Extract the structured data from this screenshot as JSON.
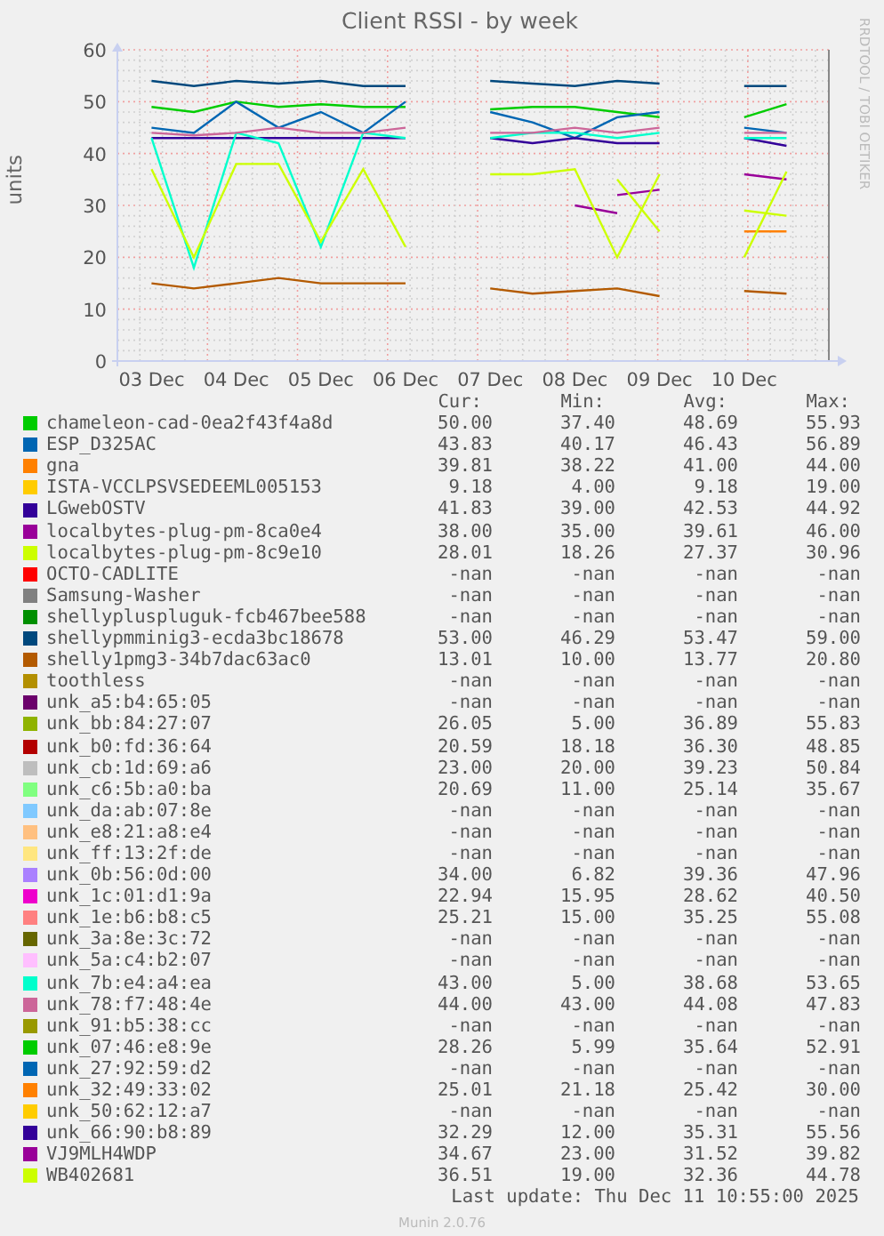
{
  "chart": {
    "side_label": "RRDTOOL / TOBI OETIKER",
    "chart_data": {
      "type": "line",
      "title": "Client RSSI - by week",
      "ylabel": "units",
      "categories": [
        "03 Dec",
        null,
        "04 Dec",
        null,
        "05 Dec",
        null,
        "06 Dec",
        null,
        "07 Dec",
        null,
        "08 Dec",
        null,
        "09 Dec",
        null,
        "10 Dec",
        null
      ],
      "ylim": [
        0,
        60
      ],
      "grid": true,
      "yticks": [
        0,
        10,
        20,
        30,
        40,
        50,
        60
      ],
      "series": [
        {
          "name": "chameleon-cad-0ea2f43f4a8d",
          "color": "#00cc00",
          "values": [
            49,
            48,
            50,
            49,
            49.5,
            49,
            49,
            null,
            48.5,
            49,
            49,
            48,
            47,
            null,
            47,
            49.5
          ]
        },
        {
          "name": "ESP_D325AC",
          "color": "#0066b3",
          "values": [
            45,
            44,
            50,
            45,
            48,
            44,
            50,
            null,
            48,
            46,
            43,
            47,
            48,
            null,
            45,
            44
          ]
        },
        {
          "name": "gna",
          "color": "#ff8000",
          "values": [
            null,
            null,
            null,
            null,
            null,
            null,
            null,
            null,
            null,
            null,
            null,
            null,
            null,
            null,
            null,
            null
          ]
        },
        {
          "name": "ISTA-VCCLPSVSEDEEML005153",
          "color": "#ffcc00",
          "values": [
            null,
            null,
            null,
            null,
            null,
            null,
            null,
            null,
            null,
            null,
            null,
            null,
            null,
            null,
            null,
            null
          ]
        },
        {
          "name": "LGwebOSTV",
          "color": "#330099",
          "values": [
            43,
            43,
            43,
            43,
            43,
            43,
            43,
            null,
            43,
            42,
            43,
            42,
            42,
            null,
            43,
            41.5
          ]
        },
        {
          "name": "localbytes-plug-pm-8ca0e4",
          "color": "#990099",
          "values": [
            null,
            null,
            null,
            null,
            null,
            null,
            null,
            null,
            null,
            null,
            null,
            32,
            33,
            null,
            36,
            35
          ]
        },
        {
          "name": "localbytes-plug-pm-8c9e10",
          "color": "#ccff00",
          "values": [
            null,
            null,
            null,
            null,
            null,
            null,
            null,
            null,
            null,
            null,
            null,
            35,
            25,
            null,
            29,
            28
          ]
        },
        {
          "name": "OCTO-CADLITE",
          "color": "#ff0000",
          "values": [
            null,
            null,
            null,
            null,
            null,
            null,
            null,
            null,
            null,
            null,
            null,
            null,
            null,
            null,
            null,
            null
          ]
        },
        {
          "name": "Samsung-Washer",
          "color": "#808080",
          "values": [
            null,
            null,
            null,
            null,
            null,
            null,
            null,
            null,
            null,
            null,
            null,
            null,
            null,
            null,
            null,
            null
          ]
        },
        {
          "name": "shellypluspluguk-fcb467bee588",
          "color": "#008f00",
          "values": [
            null,
            null,
            null,
            null,
            null,
            null,
            null,
            null,
            null,
            null,
            null,
            null,
            null,
            null,
            null,
            null
          ]
        },
        {
          "name": "shellypmminig3-ecda3bc18678",
          "color": "#00487d",
          "values": [
            54,
            53,
            54,
            53.5,
            54,
            53,
            53,
            null,
            54,
            53.5,
            53,
            54,
            53.5,
            null,
            53,
            53
          ]
        },
        {
          "name": "shelly1pmg3-34b7dac63ac0",
          "color": "#b35a00",
          "values": [
            15,
            14,
            15,
            16,
            15,
            15,
            15,
            null,
            14,
            13,
            13.5,
            14,
            12.5,
            null,
            13.5,
            13
          ]
        },
        {
          "name": "toothless",
          "color": "#b38f00",
          "values": [
            null,
            null,
            null,
            null,
            null,
            null,
            null,
            null,
            null,
            null,
            null,
            null,
            null,
            null,
            null,
            null
          ]
        },
        {
          "name": "unk_a5:b4:65:05",
          "color": "#6b006b",
          "values": [
            null,
            null,
            null,
            null,
            null,
            null,
            null,
            null,
            null,
            null,
            null,
            null,
            null,
            null,
            null,
            null
          ]
        },
        {
          "name": "unk_bb:84:27:07",
          "color": "#8fb300",
          "values": [
            null,
            null,
            null,
            null,
            null,
            null,
            null,
            null,
            null,
            null,
            null,
            null,
            null,
            null,
            null,
            null
          ]
        },
        {
          "name": "unk_b0:fd:36:64",
          "color": "#b30000",
          "values": [
            null,
            null,
            null,
            null,
            null,
            null,
            null,
            null,
            null,
            null,
            null,
            null,
            null,
            null,
            null,
            null
          ]
        },
        {
          "name": "unk_cb:1d:69:a6",
          "color": "#bebebe",
          "values": [
            null,
            null,
            null,
            null,
            null,
            null,
            null,
            null,
            null,
            null,
            null,
            null,
            null,
            null,
            null,
            null
          ]
        },
        {
          "name": "unk_c6:5b:a0:ba",
          "color": "#80ff80",
          "values": [
            null,
            null,
            null,
            null,
            null,
            null,
            null,
            null,
            null,
            null,
            null,
            null,
            null,
            null,
            null,
            null
          ]
        },
        {
          "name": "unk_da:ab:07:8e",
          "color": "#80c9ff",
          "values": [
            null,
            null,
            null,
            null,
            null,
            null,
            null,
            null,
            null,
            null,
            null,
            null,
            null,
            null,
            null,
            null
          ]
        },
        {
          "name": "unk_e8:21:a8:e4",
          "color": "#ffc080",
          "values": [
            null,
            null,
            null,
            null,
            null,
            null,
            null,
            null,
            null,
            null,
            null,
            null,
            null,
            null,
            null,
            null
          ]
        },
        {
          "name": "unk_ff:13:2f:de",
          "color": "#ffe680",
          "values": [
            null,
            null,
            null,
            null,
            null,
            null,
            null,
            null,
            null,
            null,
            null,
            null,
            null,
            null,
            null,
            null
          ]
        },
        {
          "name": "unk_0b:56:0d:00",
          "color": "#aa80ff",
          "values": [
            null,
            null,
            null,
            null,
            null,
            null,
            null,
            null,
            null,
            null,
            null,
            null,
            null,
            null,
            null,
            null
          ]
        },
        {
          "name": "unk_1c:01:d1:9a",
          "color": "#ee00cc",
          "values": [
            null,
            null,
            null,
            null,
            null,
            null,
            null,
            null,
            null,
            null,
            null,
            null,
            null,
            null,
            null,
            null
          ]
        },
        {
          "name": "unk_1e:b6:b8:c5",
          "color": "#ff8080",
          "values": [
            null,
            null,
            null,
            null,
            null,
            null,
            null,
            null,
            null,
            null,
            null,
            null,
            null,
            null,
            null,
            null
          ]
        },
        {
          "name": "unk_3a:8e:3c:72",
          "color": "#666600",
          "values": [
            null,
            null,
            null,
            null,
            null,
            null,
            null,
            null,
            null,
            null,
            null,
            null,
            null,
            null,
            null,
            null
          ]
        },
        {
          "name": "unk_5a:c4:b2:07",
          "color": "#ffbfff",
          "values": [
            null,
            null,
            null,
            null,
            null,
            null,
            null,
            null,
            null,
            null,
            null,
            null,
            null,
            null,
            null,
            null
          ]
        },
        {
          "name": "unk_7b:e4:a4:ea",
          "color": "#00ffcc",
          "values": [
            43,
            18,
            44,
            42,
            22,
            44,
            43,
            null,
            43,
            44,
            44,
            43,
            44,
            null,
            43,
            43
          ]
        },
        {
          "name": "unk_78:f7:48:4e",
          "color": "#cc6699",
          "values": [
            44,
            43.5,
            44,
            45,
            44,
            44,
            45,
            null,
            44,
            44,
            45,
            44,
            45,
            null,
            44,
            44
          ]
        },
        {
          "name": "unk_91:b5:38:cc",
          "color": "#999900",
          "values": [
            null,
            null,
            null,
            null,
            null,
            null,
            null,
            null,
            null,
            null,
            null,
            null,
            null,
            null,
            null,
            null
          ]
        },
        {
          "name": "unk_07:46:e8:9e",
          "color": "#00cc00",
          "values": [
            null,
            null,
            null,
            null,
            null,
            null,
            null,
            null,
            null,
            null,
            null,
            null,
            null,
            null,
            null,
            null
          ]
        },
        {
          "name": "unk_27:92:59:d2",
          "color": "#0066b3",
          "values": [
            null,
            null,
            null,
            null,
            null,
            null,
            null,
            null,
            null,
            null,
            null,
            null,
            null,
            null,
            null,
            null
          ]
        },
        {
          "name": "unk_32:49:33:02",
          "color": "#ff8000",
          "values": [
            null,
            null,
            null,
            null,
            null,
            null,
            null,
            null,
            null,
            null,
            null,
            null,
            null,
            null,
            25,
            25
          ]
        },
        {
          "name": "unk_50:62:12:a7",
          "color": "#ffcc00",
          "values": [
            null,
            null,
            null,
            null,
            null,
            null,
            null,
            null,
            null,
            null,
            null,
            null,
            null,
            null,
            null,
            null
          ]
        },
        {
          "name": "unk_66:90:b8:89",
          "color": "#330099",
          "values": [
            null,
            null,
            null,
            null,
            null,
            null,
            null,
            null,
            null,
            null,
            null,
            null,
            null,
            null,
            null,
            null
          ]
        },
        {
          "name": "VJ9MLH4WDP",
          "color": "#990099",
          "values": [
            null,
            null,
            null,
            null,
            null,
            null,
            null,
            null,
            null,
            null,
            30,
            28.5,
            null,
            null,
            null,
            null
          ]
        },
        {
          "name": "WB402681",
          "color": "#ccff00",
          "values": [
            37,
            20,
            38,
            38,
            23,
            37,
            22,
            null,
            36,
            36,
            37,
            20,
            36,
            null,
            20,
            36.5
          ]
        }
      ]
    }
  },
  "legend": {
    "columns": [
      "Cur:",
      "Min:",
      "Avg:",
      "Max:"
    ],
    "rows": [
      {
        "cur": "50.00",
        "min": "37.40",
        "avg": "48.69",
        "max": "55.93"
      },
      {
        "cur": "43.83",
        "min": "40.17",
        "avg": "46.43",
        "max": "56.89"
      },
      {
        "cur": "39.81",
        "min": "38.22",
        "avg": "41.00",
        "max": "44.00"
      },
      {
        "cur": "9.18",
        "min": "4.00",
        "avg": "9.18",
        "max": "19.00"
      },
      {
        "cur": "41.83",
        "min": "39.00",
        "avg": "42.53",
        "max": "44.92"
      },
      {
        "cur": "38.00",
        "min": "35.00",
        "avg": "39.61",
        "max": "46.00"
      },
      {
        "cur": "28.01",
        "min": "18.26",
        "avg": "27.37",
        "max": "30.96"
      },
      {
        "cur": "-nan",
        "min": "-nan",
        "avg": "-nan",
        "max": "-nan"
      },
      {
        "cur": "-nan",
        "min": "-nan",
        "avg": "-nan",
        "max": "-nan"
      },
      {
        "cur": "-nan",
        "min": "-nan",
        "avg": "-nan",
        "max": "-nan"
      },
      {
        "cur": "53.00",
        "min": "46.29",
        "avg": "53.47",
        "max": "59.00"
      },
      {
        "cur": "13.01",
        "min": "10.00",
        "avg": "13.77",
        "max": "20.80"
      },
      {
        "cur": "-nan",
        "min": "-nan",
        "avg": "-nan",
        "max": "-nan"
      },
      {
        "cur": "-nan",
        "min": "-nan",
        "avg": "-nan",
        "max": "-nan"
      },
      {
        "cur": "26.05",
        "min": "5.00",
        "avg": "36.89",
        "max": "55.83"
      },
      {
        "cur": "20.59",
        "min": "18.18",
        "avg": "36.30",
        "max": "48.85"
      },
      {
        "cur": "23.00",
        "min": "20.00",
        "avg": "39.23",
        "max": "50.84"
      },
      {
        "cur": "20.69",
        "min": "11.00",
        "avg": "25.14",
        "max": "35.67"
      },
      {
        "cur": "-nan",
        "min": "-nan",
        "avg": "-nan",
        "max": "-nan"
      },
      {
        "cur": "-nan",
        "min": "-nan",
        "avg": "-nan",
        "max": "-nan"
      },
      {
        "cur": "-nan",
        "min": "-nan",
        "avg": "-nan",
        "max": "-nan"
      },
      {
        "cur": "34.00",
        "min": "6.82",
        "avg": "39.36",
        "max": "47.96"
      },
      {
        "cur": "22.94",
        "min": "15.95",
        "avg": "28.62",
        "max": "40.50"
      },
      {
        "cur": "25.21",
        "min": "15.00",
        "avg": "35.25",
        "max": "55.08"
      },
      {
        "cur": "-nan",
        "min": "-nan",
        "avg": "-nan",
        "max": "-nan"
      },
      {
        "cur": "-nan",
        "min": "-nan",
        "avg": "-nan",
        "max": "-nan"
      },
      {
        "cur": "43.00",
        "min": "5.00",
        "avg": "38.68",
        "max": "53.65"
      },
      {
        "cur": "44.00",
        "min": "43.00",
        "avg": "44.08",
        "max": "47.83"
      },
      {
        "cur": "-nan",
        "min": "-nan",
        "avg": "-nan",
        "max": "-nan"
      },
      {
        "cur": "28.26",
        "min": "5.99",
        "avg": "35.64",
        "max": "52.91"
      },
      {
        "cur": "-nan",
        "min": "-nan",
        "avg": "-nan",
        "max": "-nan"
      },
      {
        "cur": "25.01",
        "min": "21.18",
        "avg": "25.42",
        "max": "30.00"
      },
      {
        "cur": "-nan",
        "min": "-nan",
        "avg": "-nan",
        "max": "-nan"
      },
      {
        "cur": "32.29",
        "min": "12.00",
        "avg": "35.31",
        "max": "55.56"
      },
      {
        "cur": "34.67",
        "min": "23.00",
        "avg": "31.52",
        "max": "39.82"
      },
      {
        "cur": "36.51",
        "min": "19.00",
        "avg": "32.36",
        "max": "44.78"
      }
    ]
  },
  "last_update": "Last update: Thu Dec 11 10:55:00 2025",
  "footer": "Munin 2.0.76"
}
